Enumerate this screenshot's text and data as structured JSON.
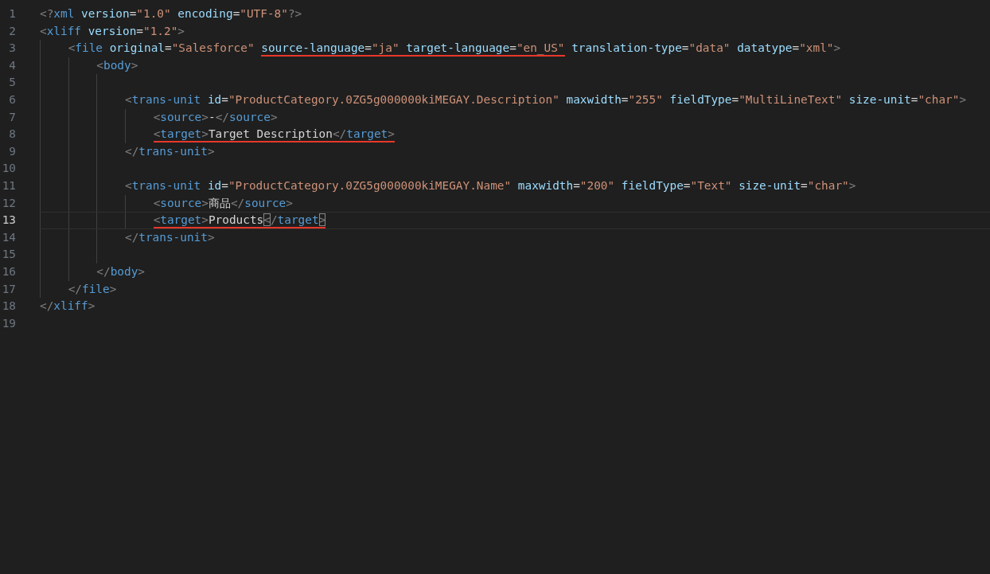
{
  "editor": {
    "lines": [
      {
        "number": "1",
        "current": false,
        "segments": [
          {
            "underlined": false,
            "tokens": [
              {
                "kind": "punct",
                "text": "<?"
              },
              {
                "kind": "tag",
                "text": "xml"
              },
              {
                "kind": "attr",
                "text": " version"
              },
              {
                "kind": "op",
                "text": "="
              },
              {
                "kind": "value",
                "text": "\"1.0\""
              },
              {
                "kind": "attr",
                "text": " encoding"
              },
              {
                "kind": "op",
                "text": "="
              },
              {
                "kind": "value",
                "text": "\"UTF-8\""
              },
              {
                "kind": "punct",
                "text": "?>"
              }
            ]
          }
        ]
      },
      {
        "number": "2",
        "current": false,
        "segments": [
          {
            "underlined": false,
            "tokens": [
              {
                "kind": "punct",
                "text": "<"
              },
              {
                "kind": "tag",
                "text": "xliff"
              },
              {
                "kind": "attr",
                "text": " version"
              },
              {
                "kind": "op",
                "text": "="
              },
              {
                "kind": "value",
                "text": "\"1.2\""
              },
              {
                "kind": "punct",
                "text": ">"
              }
            ]
          }
        ]
      },
      {
        "number": "3",
        "current": false,
        "segments": [
          {
            "underlined": false,
            "tokens": [
              {
                "kind": "punct",
                "text": "<"
              },
              {
                "kind": "tag",
                "text": "file"
              },
              {
                "kind": "attr",
                "text": " original"
              },
              {
                "kind": "op",
                "text": "="
              },
              {
                "kind": "value",
                "text": "\"Salesforce\" "
              }
            ]
          },
          {
            "underlined": true,
            "tokens": [
              {
                "kind": "attr",
                "text": "source-language"
              },
              {
                "kind": "op",
                "text": "="
              },
              {
                "kind": "value",
                "text": "\"ja\""
              },
              {
                "kind": "attr",
                "text": " target-language"
              },
              {
                "kind": "op",
                "text": "="
              },
              {
                "kind": "value",
                "text": "\"en_US\""
              }
            ]
          },
          {
            "underlined": false,
            "tokens": [
              {
                "kind": "attr",
                "text": " translation-type"
              },
              {
                "kind": "op",
                "text": "="
              },
              {
                "kind": "value",
                "text": "\"data\""
              },
              {
                "kind": "attr",
                "text": " datatype"
              },
              {
                "kind": "op",
                "text": "="
              },
              {
                "kind": "value",
                "text": "\"xml\""
              },
              {
                "kind": "punct",
                "text": ">"
              }
            ]
          }
        ]
      },
      {
        "number": "4",
        "current": false,
        "segments": [
          {
            "underlined": false,
            "tokens": [
              {
                "kind": "punct",
                "text": "<"
              },
              {
                "kind": "tag",
                "text": "body"
              },
              {
                "kind": "punct",
                "text": ">"
              }
            ]
          }
        ]
      },
      {
        "number": "5",
        "current": false
      },
      {
        "number": "6",
        "current": false,
        "segments": [
          {
            "underlined": false,
            "tokens": [
              {
                "kind": "punct",
                "text": "<"
              },
              {
                "kind": "tag",
                "text": "trans-unit"
              },
              {
                "kind": "attr",
                "text": " id"
              },
              {
                "kind": "op",
                "text": "="
              },
              {
                "kind": "value",
                "text": "\"ProductCategory.0ZG5g000000kiMEGAY.Description\""
              },
              {
                "kind": "attr",
                "text": " maxwidth"
              },
              {
                "kind": "op",
                "text": "="
              },
              {
                "kind": "value",
                "text": "\"255\""
              },
              {
                "kind": "attr",
                "text": " fieldType"
              },
              {
                "kind": "op",
                "text": "="
              },
              {
                "kind": "value",
                "text": "\"MultiLineText\""
              },
              {
                "kind": "attr",
                "text": " size-unit"
              },
              {
                "kind": "op",
                "text": "="
              },
              {
                "kind": "value",
                "text": "\"char\""
              },
              {
                "kind": "punct",
                "text": ">"
              }
            ]
          }
        ]
      },
      {
        "number": "7",
        "current": false,
        "segments": [
          {
            "underlined": false,
            "tokens": [
              {
                "kind": "punct",
                "text": "<"
              },
              {
                "kind": "tag",
                "text": "source"
              },
              {
                "kind": "punct",
                "text": ">"
              },
              {
                "kind": "op",
                "text": "-"
              },
              {
                "kind": "punct",
                "text": "</"
              },
              {
                "kind": "tag",
                "text": "source"
              },
              {
                "kind": "punct",
                "text": ">"
              }
            ]
          }
        ]
      },
      {
        "number": "8",
        "current": false,
        "segments": [
          {
            "underlined": true,
            "tokens": [
              {
                "kind": "punct",
                "text": "<"
              },
              {
                "kind": "tag",
                "text": "target"
              },
              {
                "kind": "punct",
                "text": ">"
              },
              {
                "kind": "op",
                "text": "Target Description"
              },
              {
                "kind": "punct",
                "text": "</"
              },
              {
                "kind": "tag",
                "text": "target"
              },
              {
                "kind": "punct",
                "text": ">"
              }
            ]
          }
        ]
      },
      {
        "number": "9",
        "current": false,
        "segments": [
          {
            "underlined": false,
            "tokens": [
              {
                "kind": "punct",
                "text": "</"
              },
              {
                "kind": "tag",
                "text": "trans-unit"
              },
              {
                "kind": "punct",
                "text": ">"
              }
            ]
          }
        ]
      },
      {
        "number": "10",
        "current": false
      },
      {
        "number": "11",
        "current": false,
        "segments": [
          {
            "underlined": false,
            "tokens": [
              {
                "kind": "punct",
                "text": "<"
              },
              {
                "kind": "tag",
                "text": "trans-unit"
              },
              {
                "kind": "attr",
                "text": " id"
              },
              {
                "kind": "op",
                "text": "="
              },
              {
                "kind": "value",
                "text": "\"ProductCategory.0ZG5g000000kiMEGAY.Name\""
              },
              {
                "kind": "attr",
                "text": " maxwidth"
              },
              {
                "kind": "op",
                "text": "="
              },
              {
                "kind": "value",
                "text": "\"200\""
              },
              {
                "kind": "attr",
                "text": " fieldType"
              },
              {
                "kind": "op",
                "text": "="
              },
              {
                "kind": "value",
                "text": "\"Text\""
              },
              {
                "kind": "attr",
                "text": " size-unit"
              },
              {
                "kind": "op",
                "text": "="
              },
              {
                "kind": "value",
                "text": "\"char\""
              },
              {
                "kind": "punct",
                "text": ">"
              }
            ]
          }
        ]
      },
      {
        "number": "12",
        "current": false,
        "segments": [
          {
            "underlined": false,
            "tokens": [
              {
                "kind": "punct",
                "text": "<"
              },
              {
                "kind": "tag",
                "text": "source"
              },
              {
                "kind": "punct",
                "text": ">"
              },
              {
                "kind": "op",
                "text": "商品"
              },
              {
                "kind": "punct",
                "text": "</"
              },
              {
                "kind": "tag",
                "text": "source"
              },
              {
                "kind": "punct",
                "text": ">"
              }
            ]
          }
        ]
      },
      {
        "number": "13",
        "current": true,
        "segments": [
          {
            "underlined": true,
            "tokens": [
              {
                "kind": "punct",
                "text": "<"
              },
              {
                "kind": "tag",
                "text": "target"
              },
              {
                "kind": "punct",
                "text": ">"
              },
              {
                "kind": "op",
                "text": "Products"
              },
              {
                "kind": "match",
                "text": "<"
              },
              {
                "kind": "punct",
                "text": "/"
              },
              {
                "kind": "tag",
                "text": "target"
              },
              {
                "kind": "match",
                "text": ">"
              }
            ]
          }
        ]
      },
      {
        "number": "14",
        "current": false,
        "segments": [
          {
            "underlined": false,
            "tokens": [
              {
                "kind": "punct",
                "text": "</"
              },
              {
                "kind": "tag",
                "text": "trans-unit"
              },
              {
                "kind": "punct",
                "text": ">"
              }
            ]
          }
        ]
      },
      {
        "number": "15",
        "current": false
      },
      {
        "number": "16",
        "current": false,
        "segments": [
          {
            "underlined": false,
            "tokens": [
              {
                "kind": "punct",
                "text": "</"
              },
              {
                "kind": "tag",
                "text": "body"
              },
              {
                "kind": "punct",
                "text": ">"
              }
            ]
          }
        ]
      },
      {
        "number": "17",
        "current": false,
        "segments": [
          {
            "underlined": false,
            "tokens": [
              {
                "kind": "punct",
                "text": "</"
              },
              {
                "kind": "tag",
                "text": "file"
              },
              {
                "kind": "punct",
                "text": ">"
              }
            ]
          }
        ]
      },
      {
        "number": "18",
        "current": false,
        "segments": [
          {
            "underlined": false,
            "tokens": [
              {
                "kind": "punct",
                "text": "</"
              },
              {
                "kind": "tag",
                "text": "xliff"
              },
              {
                "kind": "punct",
                "text": ">"
              }
            ]
          }
        ]
      },
      {
        "number": "19",
        "current": false
      }
    ]
  }
}
